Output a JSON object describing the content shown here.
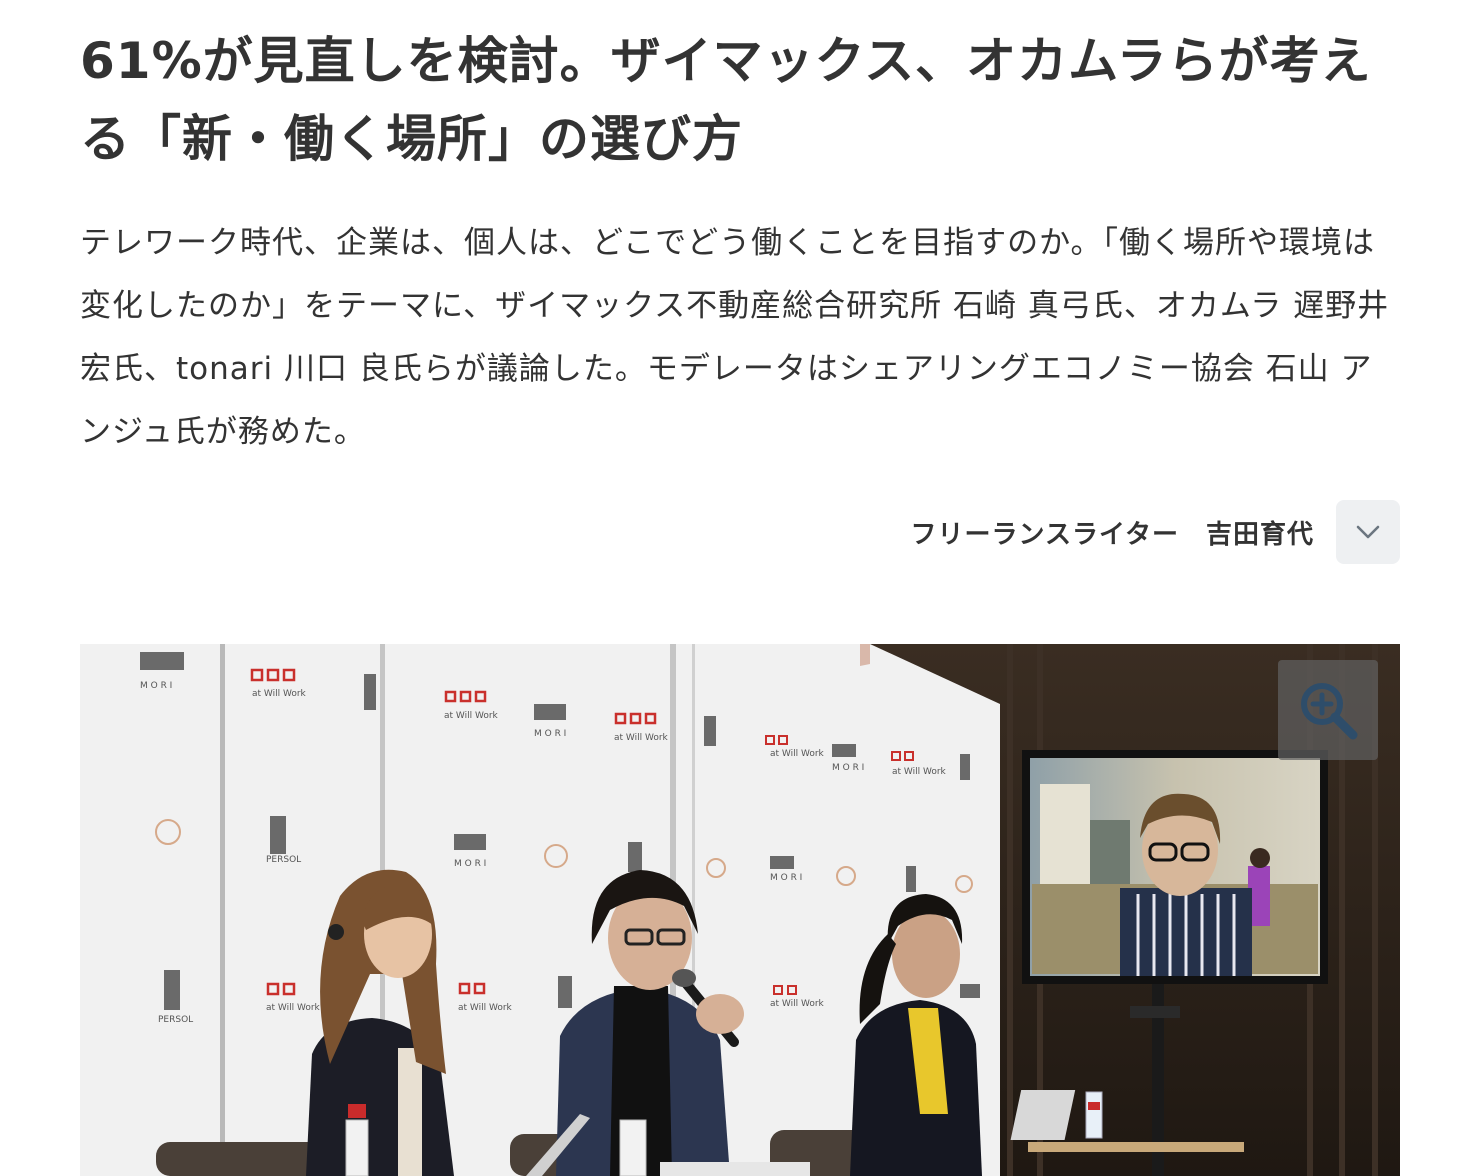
{
  "article": {
    "title": "61%が見直しを検討。ザイマックス、オカムラらが考える「新・働く場所」の選び方",
    "lead": "テレワーク時代、企業は、個人は、どこでどう働くことを目指すのか。「働く場所や環境は変化したのか」をテーマに、ザイマックス不動産総合研究所 石崎 真弓氏、オカムラ 遅野井 宏氏、tonari 川口 良氏らが議論した。モデレータはシェアリングエコノミー協会 石山 アンジュ氏が務めた。",
    "author": "フリーランスライター　吉田育代"
  },
  "icons": {
    "expand": "chevron-down-icon",
    "zoom": "zoom-in-icon"
  },
  "photo": {
    "backdrop_logos": [
      "MORI",
      "at Will Work",
      "PERSOL"
    ]
  },
  "colors": {
    "text": "#333333",
    "button_bg": "#eef0f2",
    "logo_red": "#c9302c"
  }
}
